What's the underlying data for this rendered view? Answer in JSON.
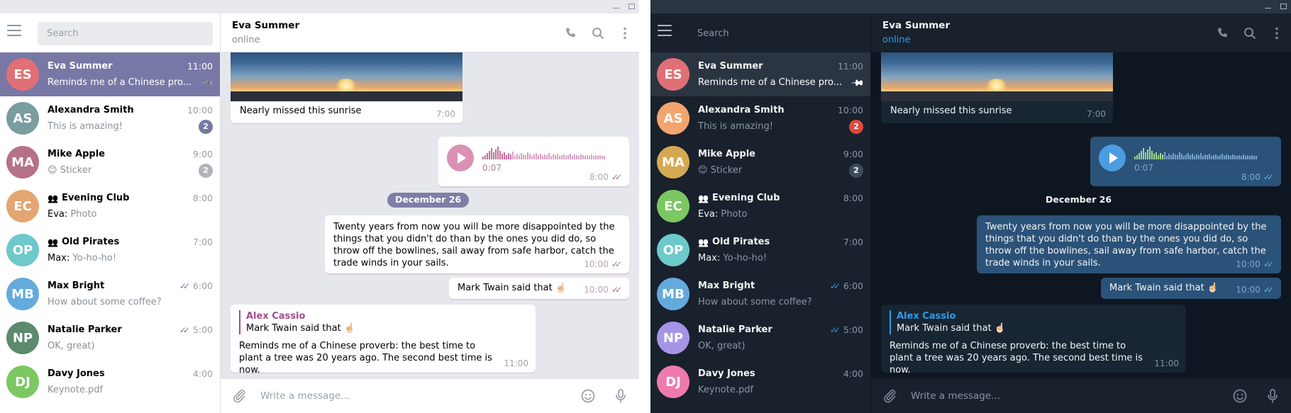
{
  "app": {
    "search_placeholder": "Search",
    "composer_placeholder": "Write a message...",
    "header": {
      "title": "Eva Summer",
      "status": "online"
    }
  },
  "themes": {
    "light": {
      "accent": "#7878a6",
      "badge": "#7878a6",
      "badge_muted": "#b0b4b9"
    },
    "dark": {
      "accent": "#2f9de8",
      "badge": "#e0483e",
      "badge_muted": "#3e4a57"
    }
  },
  "chats": [
    {
      "initials": "ES",
      "name": "Eva Summer",
      "time": "11:00",
      "preview": "Reminds me of a Chinese pro...",
      "pinned": true,
      "color": "#e17076",
      "active": true
    },
    {
      "initials": "AS",
      "name": "Alexandra Smith",
      "time": "10:00",
      "preview": "This is amazing!",
      "badge": "2",
      "color_light": "#7a9da0",
      "color_dark": "#f3a56e"
    },
    {
      "initials": "MA",
      "name": "Mike Apple",
      "time": "9:00",
      "preview_emoji": "😊",
      "preview": "Sticker",
      "badge": "2",
      "color_light": "#b67189",
      "color_dark": "#d5a952"
    },
    {
      "initials": "EC",
      "name": "Evening Club",
      "group": true,
      "time": "8:00",
      "sender": "Eva:",
      "preview": "Photo",
      "color_light": "#e3a672",
      "color_dark": "#7bc862"
    },
    {
      "initials": "OP",
      "name": "Old Pirates",
      "group": true,
      "time": "7:00",
      "sender": "Max:",
      "preview": "Yo-ho-ho!",
      "color": "#6ec9cb"
    },
    {
      "initials": "MB",
      "name": "Max Bright",
      "time": "6:00",
      "read": true,
      "preview": "How about some coffee?",
      "color": "#65aadd"
    },
    {
      "initials": "NP",
      "name": "Natalie Parker",
      "time": "5:00",
      "read": true,
      "preview": "OK, great)",
      "color_light": "#5c8a6c",
      "color_dark": "#a695e7"
    },
    {
      "initials": "DJ",
      "name": "Davy Jones",
      "time": "4:00",
      "preview": "Keynote.pdf",
      "color_light": "#7bc862",
      "color_dark": "#ee7aae"
    }
  ],
  "messages": {
    "photo_caption": "Nearly missed this sunrise",
    "photo_time": "7:00",
    "voice_duration": "0:07",
    "voice_time": "8:00",
    "date_separator": "December 26",
    "quote_text": "Twenty years from now you will be more disappointed by the things that you didn't do than by the ones you did do, so throw off the bowlines, sail away from safe harbor, catch the trade winds in your sails.",
    "quote_time": "10:00",
    "attrib_text": "Mark Twain said that ☝🏻",
    "attrib_time": "10:00",
    "reply_name": "Alex Cassio",
    "reply_quote": "Mark Twain said that ☝🏻",
    "reply_text": "Reminds me of a Chinese proverb: the best time to plant a tree was 20 years ago. The second best time is now.",
    "reply_time": "11:00"
  }
}
